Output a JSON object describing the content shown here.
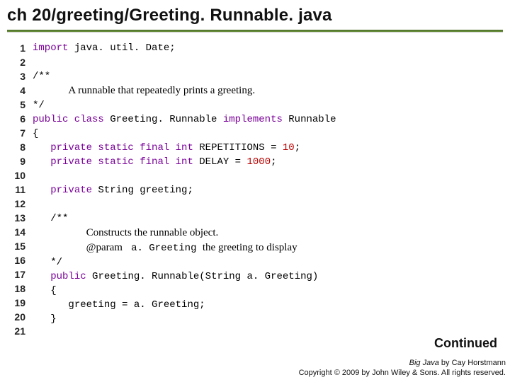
{
  "title": "ch 20/greeting/Greeting. Runnable. java",
  "gutter": " 1\n 2\n 3\n 4\n 5\n 6\n 7\n 8\n 9\n10\n11\n12\n13\n14\n15\n16\n17\n18\n19\n20\n21",
  "code": {
    "l1_kw": "import",
    "l1_rest": " java. util. Date;",
    "l3": "/**",
    "l4_lead": "      ",
    "l4_text": "A runnable that repeatedly prints a greeting.",
    "l5": "*/",
    "l6_1": "public class",
    "l6_2": " Greeting. Runnable ",
    "l6_3": "implements",
    "l6_4": " Runnable",
    "l7": "{",
    "l8_pad": "   ",
    "l8_1": "private static final int",
    "l8_2": " REPETITIONS = ",
    "l8_num": "10",
    "l8_3": ";",
    "l9_pad": "   ",
    "l9_1": "private static final int",
    "l9_2": " DELAY = ",
    "l9_num": "1000",
    "l9_3": ";",
    "l11_pad": "   ",
    "l11_1": "private",
    "l11_2": " String greeting;",
    "l13_pad": "   ",
    "l13": "/**",
    "l14_pad": "         ",
    "l14": "Constructs the runnable object.",
    "l15_pad": "         ",
    "l15_a": "@param ",
    "l15_b": " a. Greeting ",
    "l15_c": "the greeting to display",
    "l16_pad": "   ",
    "l16": "*/",
    "l17_pad": "   ",
    "l17_1": "public",
    "l17_2": " Greeting. Runnable(String a. Greeting)",
    "l18_pad": "   ",
    "l18": "{",
    "l19_pad": "      ",
    "l19": "greeting = a. Greeting;",
    "l20_pad": "   ",
    "l20": "}"
  },
  "continued": "Continued",
  "footer": {
    "line1_i": "Big Java",
    "line1_r": " by Cay Horstmann",
    "line2": "Copyright © 2009 by John Wiley & Sons. All rights reserved."
  }
}
